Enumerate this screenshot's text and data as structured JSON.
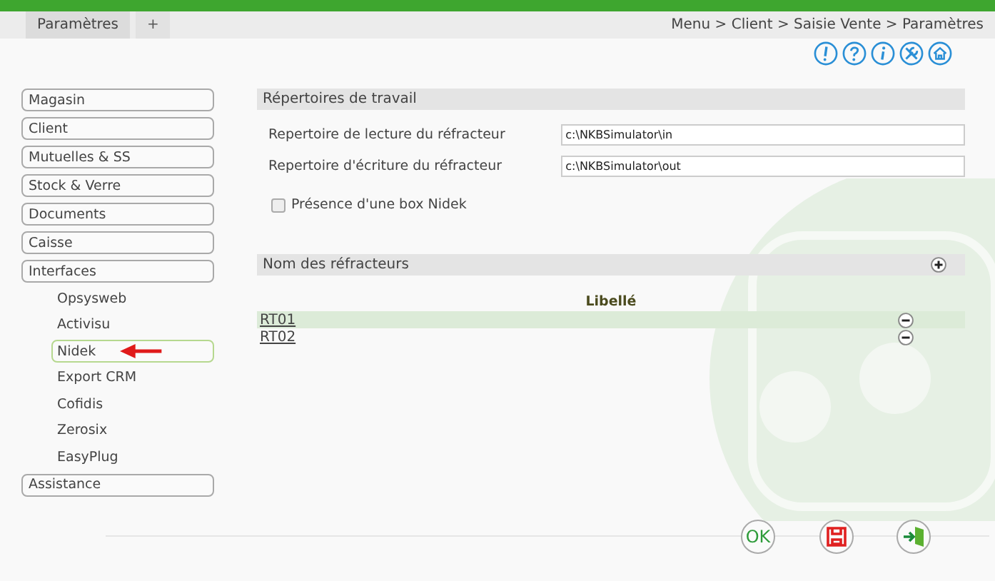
{
  "tabs": [
    {
      "label": "Paramètres",
      "selected": true
    },
    {
      "label": "+",
      "selected": false
    }
  ],
  "breadcrumb": "Menu > Client > Saisie Vente > Paramètres",
  "toolbar_icons": [
    {
      "kind": "alert"
    },
    {
      "kind": "help"
    },
    {
      "kind": "info"
    },
    {
      "kind": "tools"
    },
    {
      "kind": "home"
    }
  ],
  "sidebar": {
    "items": [
      {
        "label": "Magasin",
        "selected": false
      },
      {
        "label": "Client",
        "selected": false
      },
      {
        "label": "Mutuelles & SS",
        "selected": false
      },
      {
        "label": "Stock & Verre",
        "selected": false
      },
      {
        "label": "Documents",
        "selected": false
      },
      {
        "label": "Caisse",
        "selected": false
      },
      {
        "label": "Interfaces",
        "selected": false,
        "children": [
          {
            "label": "Opsysweb",
            "selected": false
          },
          {
            "label": "Activisu",
            "selected": false
          },
          {
            "label": "Nidek",
            "selected": true,
            "pointer": true
          },
          {
            "label": "Export CRM",
            "selected": false
          },
          {
            "label": "Cofidis",
            "selected": false
          },
          {
            "label": "Zerosix",
            "selected": false
          },
          {
            "label": "EasyPlug",
            "selected": false
          }
        ]
      },
      {
        "label": "Assistance",
        "selected": false
      }
    ]
  },
  "work_dirs": {
    "title": "Répertoires de travail",
    "fields": [
      {
        "label": "Repertoire de lecture du réfracteur",
        "value": "c:\\NKBSimulator\\in"
      },
      {
        "label": "Repertoire d'écriture du réfracteur",
        "value": "c:\\NKBSimulator\\out"
      }
    ],
    "checkbox": {
      "label": "Présence d'une box Nidek",
      "checked": false
    }
  },
  "refractors": {
    "title": "Nom des réfracteurs",
    "column": "Libellé",
    "rows": [
      {
        "name": "RT01",
        "selected": true
      },
      {
        "name": "RT02",
        "selected": false
      }
    ]
  },
  "footer_buttons": [
    {
      "kind": "ok",
      "label": "OK"
    },
    {
      "kind": "save"
    },
    {
      "kind": "exit"
    }
  ]
}
